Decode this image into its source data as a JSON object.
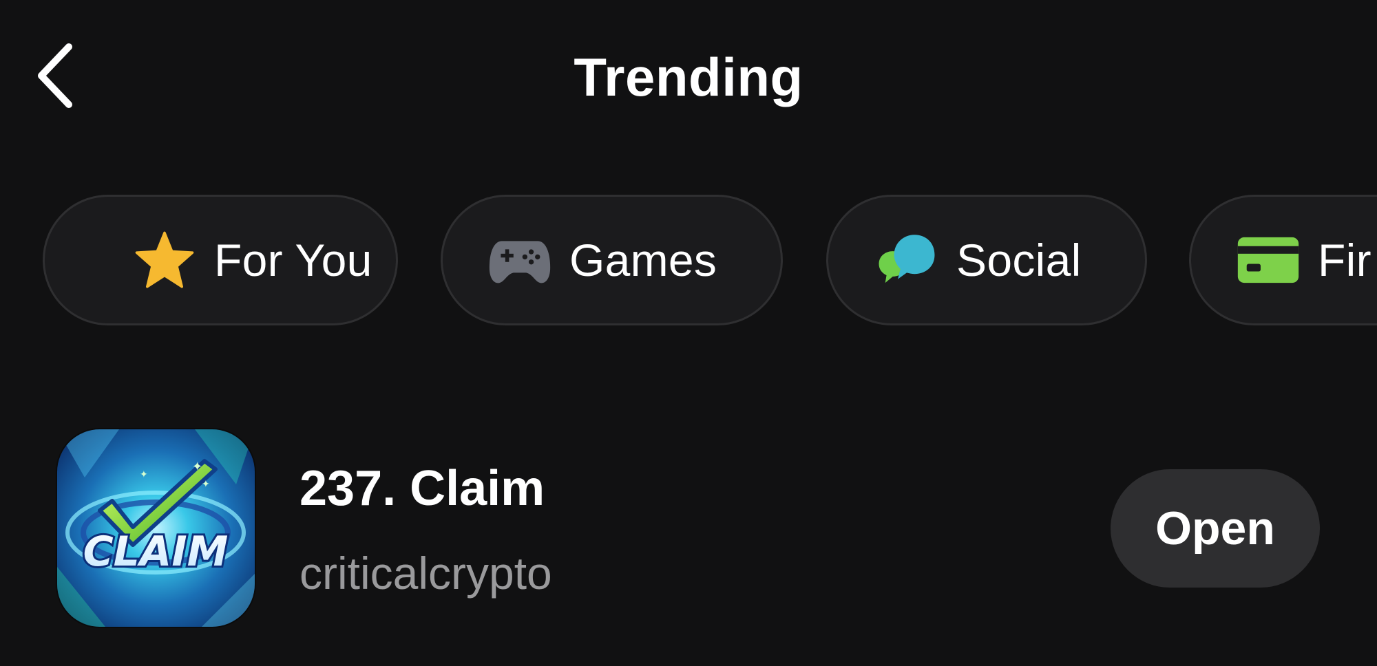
{
  "header": {
    "title": "Trending",
    "back_icon": "chevron-left-icon"
  },
  "categories": [
    {
      "label": "For You",
      "icon": "star-icon",
      "icon_color": "#f6b930"
    },
    {
      "label": "Games",
      "icon": "gamepad-icon",
      "icon_color": "#6c6f78"
    },
    {
      "label": "Social",
      "icon": "chat-bubbles-icon",
      "icon_color": "#3cb7d0"
    },
    {
      "label": "Fir",
      "icon": "credit-card-icon",
      "icon_color": "#7ed14a"
    }
  ],
  "apps": [
    {
      "name": "237. Claim",
      "author": "criticalcrypto",
      "icon_text": "CLAIM",
      "action_label": "Open"
    }
  ],
  "colors": {
    "background": "#111112",
    "chip_background": "#1b1b1d",
    "chip_border": "#2f2f31",
    "button_background": "#2e2e30",
    "secondary_text": "#9a9a9c"
  }
}
